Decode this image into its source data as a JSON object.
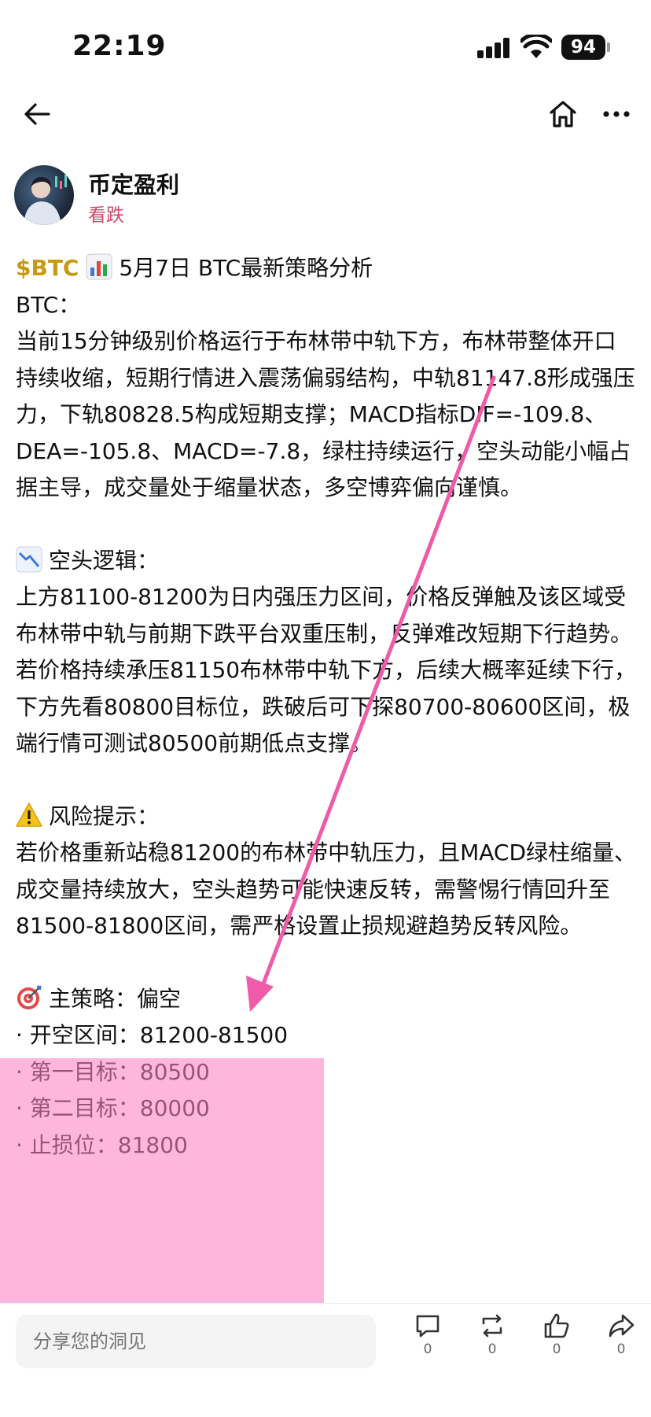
{
  "status_bar": {
    "time": "22:19",
    "battery": "94"
  },
  "author": {
    "name": "币定盈利",
    "tag": "看跌"
  },
  "post": {
    "ticker": "$BTC",
    "title": "5月7日 BTC最新策略分析",
    "lines": {
      "p1": "BTC：",
      "p2": "当前15分钟级别价格运行于布林带中轨下方，布林带整体开口持续收缩，短期行情进入震荡偏弱结构，中轨81147.8形成强压力，下轨80828.5构成短期支撑；MACD指标DIF=-109.8、DEA=-105.8、MACD=-7.8，绿柱持续运行，空头动能小幅占据主导，成交量处于缩量状态，多空博弈偏向谨慎。",
      "bear_heading": "空头逻辑：",
      "bear_body": "上方81100-81200为日内强压力区间，价格反弹触及该区域受布林带中轨与前期下跌平台双重压制，反弹难改短期下行趋势。若价格持续承压81150布林带中轨下方，后续大概率延续下行，下方先看80800目标位，跌破后可下探80700-80600区间，极端行情可测试80500前期低点支撑。",
      "risk_heading": "风险提示：",
      "risk_body": "若价格重新站稳81200的布林带中轨压力，且MACD绿柱缩量、成交量持续放大，空头趋势可能快速反转，需警惕行情回升至81500-81800区间，需严格设置止损规避趋势反转风险。",
      "strategy_heading": "主策略：偏空",
      "entry": "· 开空区间：81200-81500",
      "target1": "· 第一目标：80500",
      "target2": "· 第二目标：80000",
      "stop": "· 止损位：81800"
    }
  },
  "bottom_bar": {
    "input_placeholder": "分享您的洞见",
    "comment_count": "0",
    "repost_count": "0",
    "like_count": "0",
    "share_count": "0"
  },
  "icons": [
    "back-arrow-icon",
    "home-icon",
    "more-icon",
    "chart-bar-icon",
    "chart-down-icon",
    "warning-icon",
    "target-icon",
    "comment-icon",
    "repost-icon",
    "like-icon",
    "share-icon"
  ],
  "colors": {
    "ticker": "#c79a14",
    "tag": "#d2486b",
    "highlight": "#ff82c3",
    "arrow": "#ee5ba8"
  }
}
